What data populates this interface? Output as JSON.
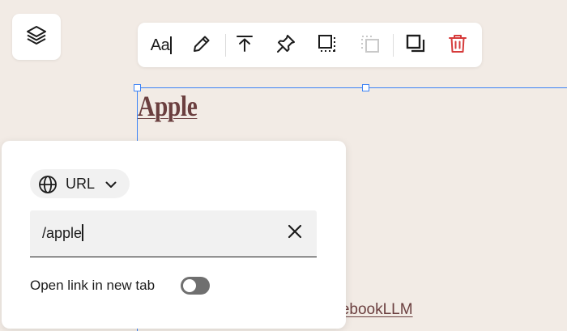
{
  "layers_button": {
    "icon": "layers-icon"
  },
  "toolbar": {
    "text_style_label": "Aa",
    "tools": [
      {
        "name": "text-style",
        "icon": "text-style-icon"
      },
      {
        "name": "edit",
        "icon": "pencil-icon"
      },
      {
        "name": "align-top",
        "icon": "align-top-icon"
      },
      {
        "name": "pin",
        "icon": "pin-icon"
      },
      {
        "name": "select-area",
        "icon": "select-area-icon"
      },
      {
        "name": "select-area-disabled",
        "icon": "dashed-square-icon",
        "disabled": true
      },
      {
        "name": "duplicate",
        "icon": "duplicate-icon"
      },
      {
        "name": "delete",
        "icon": "trash-icon",
        "color": "#d63a3a"
      }
    ]
  },
  "canvas": {
    "selected_link_text": "Apple",
    "bottom_link_text": "otebookLLM",
    "link_color": "#6b3f3f",
    "selection_color": "#3b82f6"
  },
  "link_panel": {
    "type_label": "URL",
    "type_icon": "globe-icon",
    "url_value": "/apple",
    "clear_icon": "close-icon",
    "new_tab_label": "Open link in new tab",
    "new_tab_enabled": false
  }
}
